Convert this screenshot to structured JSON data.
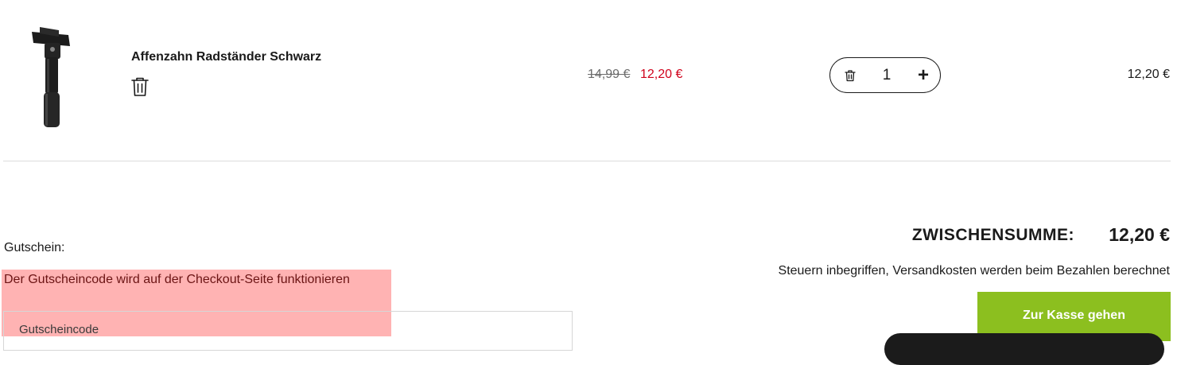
{
  "cart_item": {
    "title": "Affenzahn Radständer Schwarz",
    "image_icon": "bike-stand-product-image",
    "remove_icon": "trash-icon",
    "price_original": "14,99 €",
    "price_sale": "12,20 €",
    "quantity": "1",
    "line_total": "12,20 €"
  },
  "coupon": {
    "label": "Gutschein:",
    "note": "Der Gutscheincode wird auf der Checkout-Seite funktionieren",
    "placeholder": "Gutscheincode"
  },
  "summary": {
    "subtotal_label": "ZWISCHENSUMME:",
    "subtotal_value": "12,20 €",
    "tax_note": "Steuern inbegriffen, Versandkosten werden beim Bezahlen berechnet",
    "checkout_label": "Zur Kasse gehen"
  },
  "colors": {
    "sale_price": "#d0021b",
    "checkout_button": "#8cbf1f",
    "note_highlight": "#ffb3b3"
  }
}
